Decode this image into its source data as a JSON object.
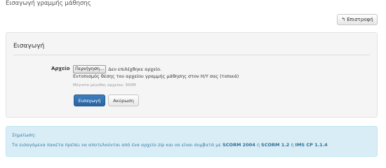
{
  "page": {
    "title": "Εισαγωγή γραμμής μάθησης"
  },
  "toolbar": {
    "back_icon": "reply-arrow-icon",
    "back_label": "Επιστροφή"
  },
  "form": {
    "legend": "Εισαγωγή",
    "file": {
      "label": "Αρχείο",
      "browse_label": "Περιήγηση...",
      "status": "Δεν επιλέχθηκε αρχείο.",
      "help": "Εντοπισμός θέσης του αρχείου γραμμής μάθησης στον Η/Υ σας (τοπικά)",
      "max_size": "Μέγιστο μέγεθος αρχείου: 300M"
    },
    "submit_label": "Εισαγωγή",
    "cancel_label": "Ακύρωση"
  },
  "note": {
    "title": "Σημείωση:",
    "text_prefix": "Τα εισαγόμενα πακέτα πρέπει να αποτελούνται από ένα αρχείο zip και να είναι συμβατά με ",
    "fmt1": "SCORM 2004",
    "or1": " ή ",
    "fmt2": "SCORM 1.2",
    "or2": " ή ",
    "fmt3": "IMS CP 1.1.4"
  },
  "colors": {
    "primary_button": "#2f6faa",
    "note_background": "#d9edf7",
    "note_text": "#3a7da3",
    "panel_background": "#f5f5f5"
  }
}
